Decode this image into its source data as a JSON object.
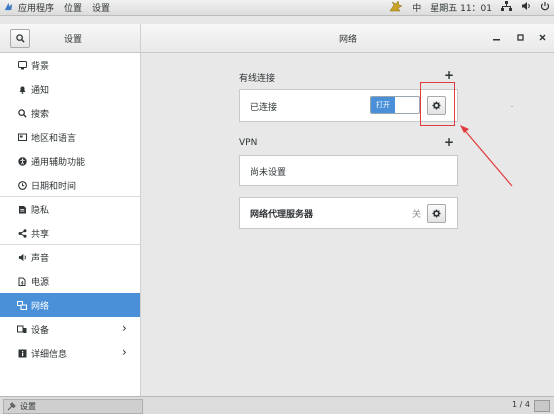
{
  "topbar": {
    "menu": [
      "应用程序",
      "位置",
      "设置"
    ],
    "input_method": "中",
    "clock": "星期五 11：01"
  },
  "header": {
    "sidebar_title": "设置",
    "main_title": "网络"
  },
  "sidebar": {
    "items": [
      {
        "label": "背景",
        "icon": "background-icon"
      },
      {
        "label": "通知",
        "icon": "bell-icon"
      },
      {
        "label": "搜索",
        "icon": "search-icon"
      },
      {
        "label": "地区和语言",
        "icon": "flag-icon"
      },
      {
        "label": "通用辅助功能",
        "icon": "accessibility-icon"
      },
      {
        "label": "日期和时间",
        "icon": "clock-icon"
      },
      {
        "label": "隐私",
        "icon": "privacy-icon"
      },
      {
        "label": "共享",
        "icon": "share-icon"
      },
      {
        "label": "声音",
        "icon": "speaker-icon"
      },
      {
        "label": "电源",
        "icon": "power-icon"
      },
      {
        "label": "网络",
        "icon": "network-icon",
        "active": true
      },
      {
        "label": "设备",
        "icon": "devices-icon"
      },
      {
        "label": "详细信息",
        "icon": "info-icon"
      }
    ]
  },
  "wired": {
    "title": "有线连接",
    "status": "已连接",
    "switch_label": "打开"
  },
  "vpn": {
    "title": "VPN",
    "empty": "尚未设置"
  },
  "proxy": {
    "title": "网络代理服务器",
    "state": "关"
  },
  "taskbar": {
    "task_label": "设置",
    "pager": "1 / 4"
  },
  "colors": {
    "accent": "#4a90d9",
    "annotation": "#e23b3b"
  }
}
